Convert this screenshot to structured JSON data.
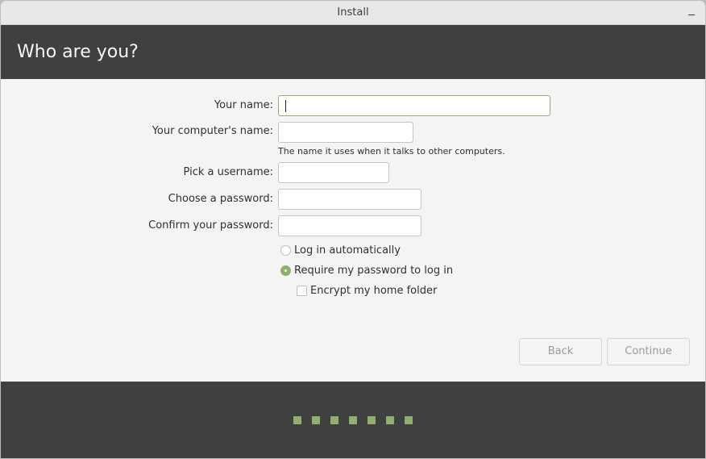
{
  "window": {
    "title": "Install",
    "minimize_icon": "minimize-icon"
  },
  "header": {
    "title": "Who are you?"
  },
  "form": {
    "your_name": {
      "label": "Your name:",
      "value": "",
      "placeholder": ""
    },
    "computer_name": {
      "label": "Your computer's name:",
      "value": "",
      "placeholder": "",
      "hint": "The name it uses when it talks to other computers."
    },
    "username": {
      "label": "Pick a username:",
      "value": "",
      "placeholder": ""
    },
    "password": {
      "label": "Choose a password:",
      "value": "",
      "placeholder": ""
    },
    "confirm_password": {
      "label": "Confirm your password:",
      "value": "",
      "placeholder": ""
    },
    "login_options": [
      {
        "label": "Log in automatically",
        "selected": false
      },
      {
        "label": "Require my password to log in",
        "selected": true
      }
    ],
    "encrypt_home": {
      "label": "Encrypt my home folder",
      "checked": false
    }
  },
  "buttons": {
    "back": "Back",
    "continue": "Continue"
  },
  "progress": {
    "total_steps": 7,
    "completed_steps": 7,
    "accent_color": "#8fb06f"
  },
  "colors": {
    "header_bg": "#404040",
    "accent": "#8fb06f"
  }
}
